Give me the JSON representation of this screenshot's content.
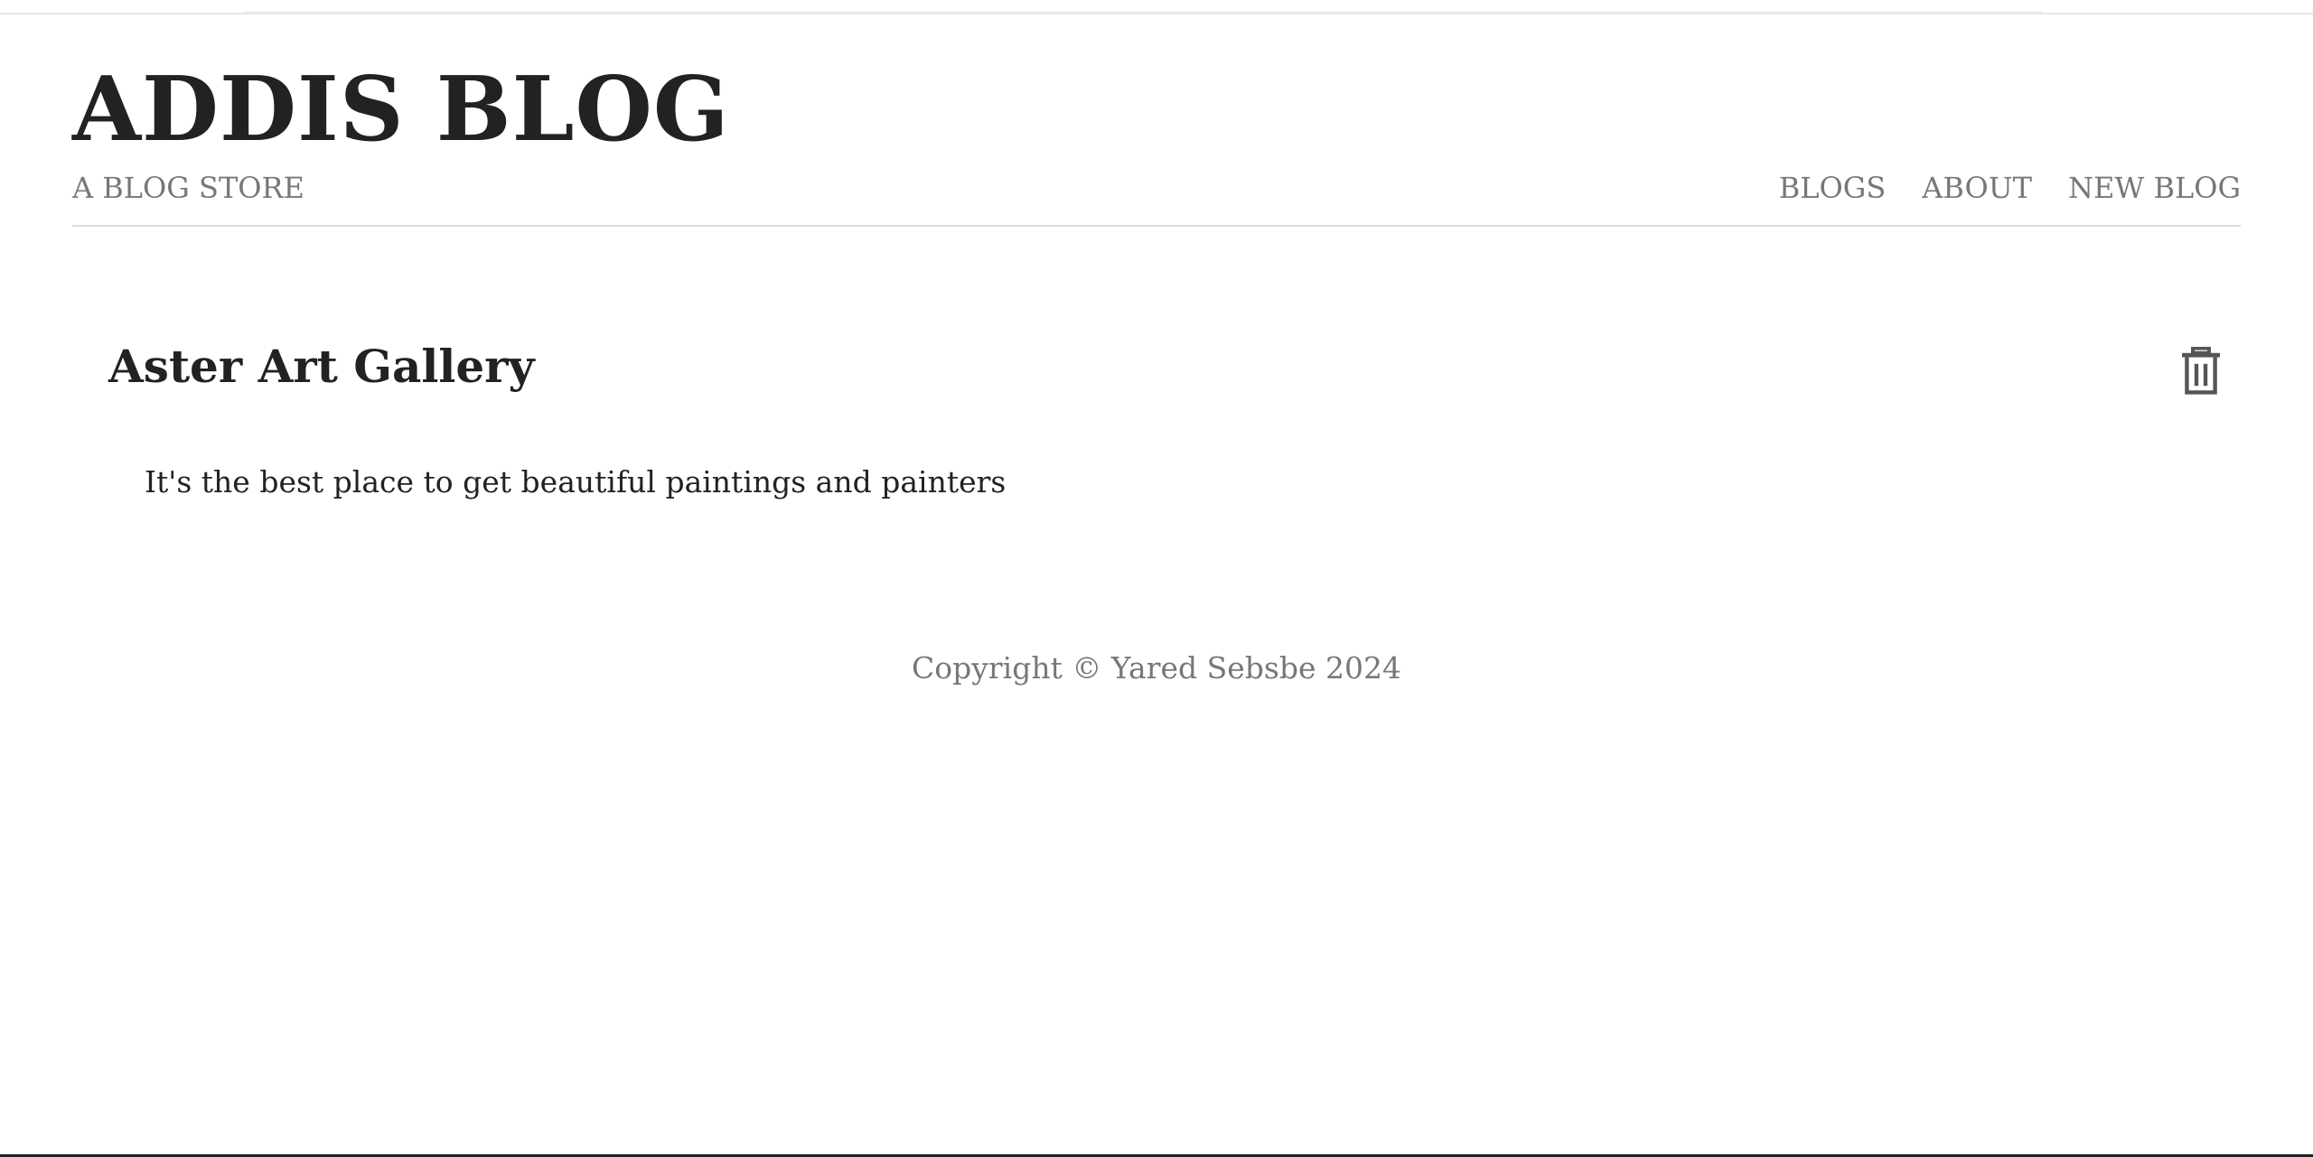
{
  "header": {
    "site_title": "ADDIS BLOG",
    "tagline": "A BLOG STORE",
    "nav": [
      {
        "label": "BLOGS"
      },
      {
        "label": "ABOUT"
      },
      {
        "label": "NEW BLOG"
      }
    ]
  },
  "post": {
    "title": "Aster Art Gallery",
    "body": "It's the best place to get beautiful paintings and painters",
    "delete_icon": "trash-icon"
  },
  "footer": {
    "copyright": "Copyright © Yared Sebsbe 2024"
  },
  "colors": {
    "text": "#222222",
    "muted": "#777777",
    "divider": "#dddddd",
    "background": "#ffffff"
  }
}
